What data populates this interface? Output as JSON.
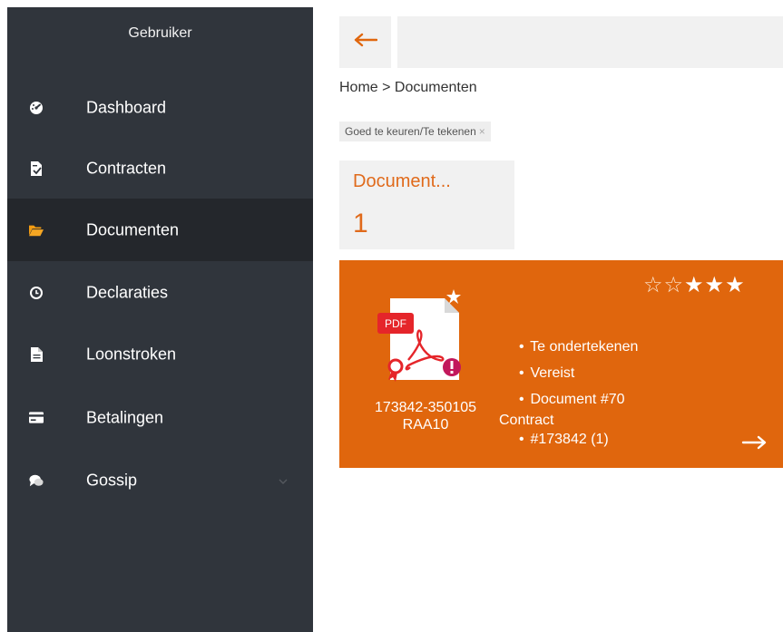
{
  "sidebar": {
    "title": "Gebruiker",
    "items": [
      {
        "label": "Dashboard",
        "icon": "dashboard-icon",
        "active": false
      },
      {
        "label": "Contracten",
        "icon": "contract-icon",
        "active": false
      },
      {
        "label": "Documenten",
        "icon": "folder-open-icon",
        "active": true
      },
      {
        "label": "Declaraties",
        "icon": "clock-icon",
        "active": false
      },
      {
        "label": "Loonstroken",
        "icon": "file-icon",
        "active": false
      },
      {
        "label": "Betalingen",
        "icon": "credit-card-icon",
        "active": false
      },
      {
        "label": "Gossip",
        "icon": "comments-icon",
        "active": false,
        "has_submenu": true
      }
    ]
  },
  "header": {
    "back_icon": "arrow-left-icon"
  },
  "breadcrumb": "Home > Documenten",
  "filter": {
    "label": "Goed te keuren/Te tekenen",
    "close": "×"
  },
  "count_tile": {
    "title": "Document...",
    "value": "1"
  },
  "document_card": {
    "rating": {
      "filled": 3,
      "max": 5
    },
    "file_type": "PDF",
    "file_icon": "pdf-file-icon",
    "id_line1": "173842-350105",
    "id_line2": "RAA10",
    "props": [
      "Te ondertekenen",
      "Vereist",
      "Document #70"
    ],
    "type_label": "Contract",
    "ref": "#173842 (1)",
    "open_icon": "arrow-right-icon"
  },
  "colors": {
    "sidebar_bg": "#30353c",
    "sidebar_active_bg": "#24272c",
    "accent": "#e0660d",
    "tile_bg": "#f1f1f1",
    "folder": "#f39c12"
  }
}
